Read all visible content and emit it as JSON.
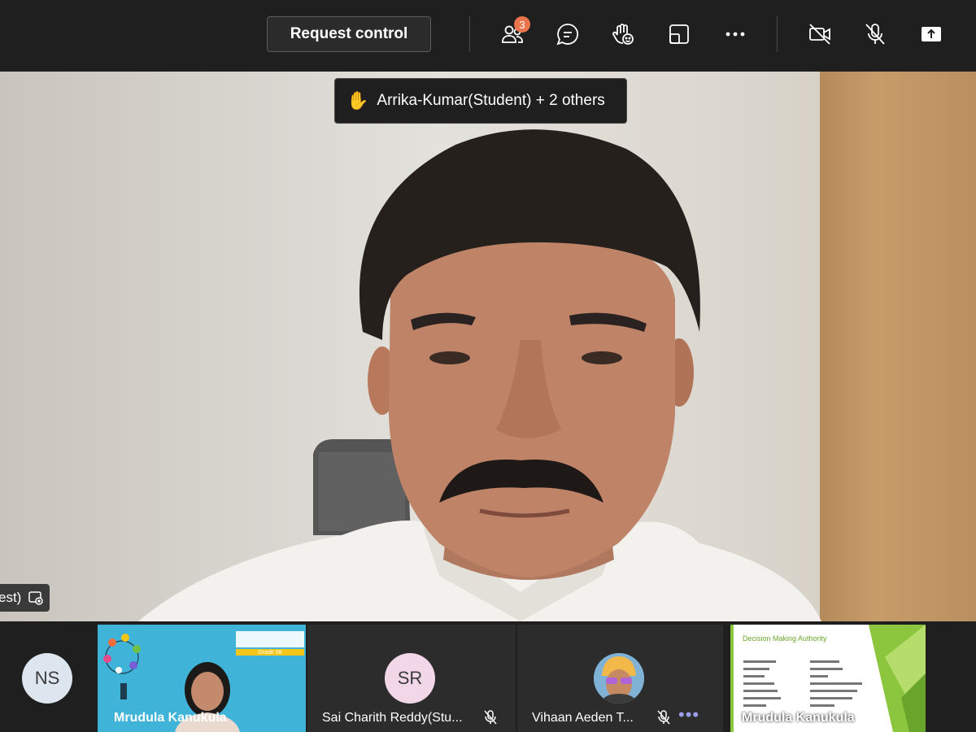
{
  "toolbar": {
    "request_control_label": "Request control",
    "participants_count": "3",
    "icons": [
      "people-icon",
      "chat-icon",
      "raise-hand-icon",
      "share-tray-icon",
      "more-options-icon",
      "camera-off-icon",
      "mic-off-icon",
      "share-screen-icon"
    ]
  },
  "main_video": {
    "raised_hands_notice": "Arrika-Kumar(Student) + 2 others",
    "speaker_name_fragment": "est)"
  },
  "participants": [
    {
      "initials": "NS",
      "name": ""
    },
    {
      "name": "Mrudula Kanukula",
      "slide_caption": "Grade 08"
    },
    {
      "initials": "SR",
      "name": "Sai Charith Reddy(Stu..."
    },
    {
      "name": "Vihaan Aeden T..."
    },
    {
      "name": "Mrudula Kanukula",
      "slide_title": "Decision Making Authority"
    }
  ],
  "colors": {
    "bar_bg": "#1f1f1f",
    "badge": "#e9744b",
    "ns_avatar": "#dde6ee",
    "sr_avatar": "#f1d7e8",
    "slide_teal": "#3fb3d8",
    "slide_green": "#8cc63f"
  }
}
